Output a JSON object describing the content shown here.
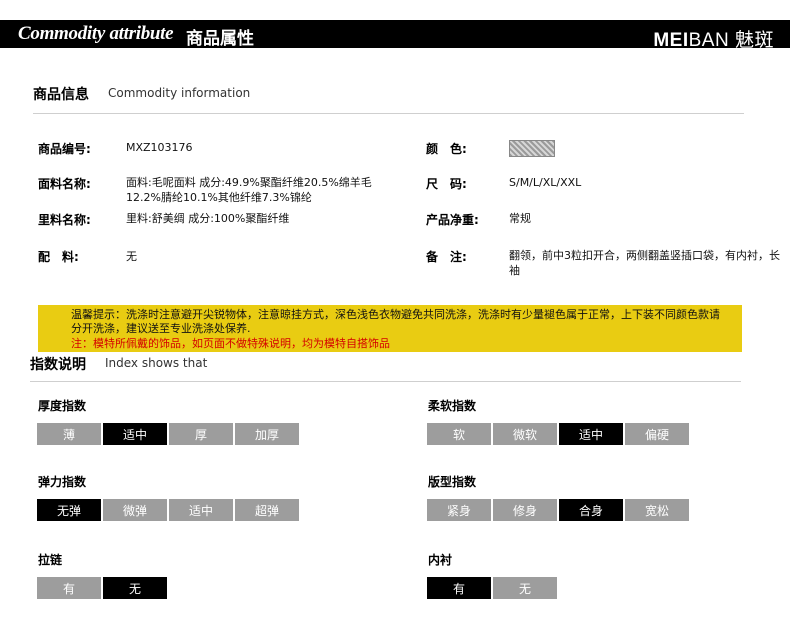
{
  "header": {
    "title_en": "Commodity attribute",
    "title_cn": "商品属性",
    "brand_bold": "MEI",
    "brand_light": "BAN",
    "brand_cn": "魅斑"
  },
  "info_section": {
    "title": "商品信息",
    "subtitle": "Commodity information"
  },
  "info": {
    "code_label": "商品编号:",
    "code_value": "MXZ103176",
    "color_label": "颜　色:",
    "fabric_label": "面料名称:",
    "fabric_value": "面料:毛呢面料 成分:49.9%聚酯纤维20.5%绵羊毛12.2%腈纶10.1%其他纤维7.3%锦纶",
    "size_label": "尺　码:",
    "size_value": "S/M/L/XL/XXL",
    "lining_label": "里料名称:",
    "lining_value": "里料:舒美绸 成分:100%聚酯纤维",
    "weight_label": "产品净重:",
    "weight_value": "常规",
    "accessory_label": "配　料:",
    "accessory_value": "无",
    "remark_label": "备　注:",
    "remark_value": "翻领，前中3粒扣开合，两侧翻盖竖插口袋，有内衬，长袖"
  },
  "notice": {
    "line1": "温馨提示：洗涤时注意避开尖锐物体，注意晾挂方式，深色浅色衣物避免共同洗涤，洗涤时有少量褪色属于正常，上下装不同颜色款请分开洗涤，建议送至专业洗涤处保养.",
    "line2": "注：模特所佩戴的饰品，如页面不做特殊说明，均为模特自搭饰品",
    "accent_color": "#e9cc12",
    "warning_color": "#d40000"
  },
  "index_section": {
    "title": "指数说明",
    "subtitle": "Index shows that"
  },
  "indices": {
    "thickness": {
      "title": "厚度指数",
      "options": [
        "薄",
        "适中",
        "厚",
        "加厚"
      ],
      "selected": 1
    },
    "softness": {
      "title": "柔软指数",
      "options": [
        "软",
        "微软",
        "适中",
        "偏硬"
      ],
      "selected": 2
    },
    "elasticity": {
      "title": "弹力指数",
      "options": [
        "无弹",
        "微弹",
        "适中",
        "超弹"
      ],
      "selected": 0
    },
    "fit": {
      "title": "版型指数",
      "options": [
        "紧身",
        "修身",
        "合身",
        "宽松"
      ],
      "selected": 2
    },
    "zipper": {
      "title": "拉链",
      "options": [
        "有",
        "无"
      ],
      "selected": 1
    },
    "lining": {
      "title": "内衬",
      "options": [
        "有",
        "无"
      ],
      "selected": 0
    }
  }
}
